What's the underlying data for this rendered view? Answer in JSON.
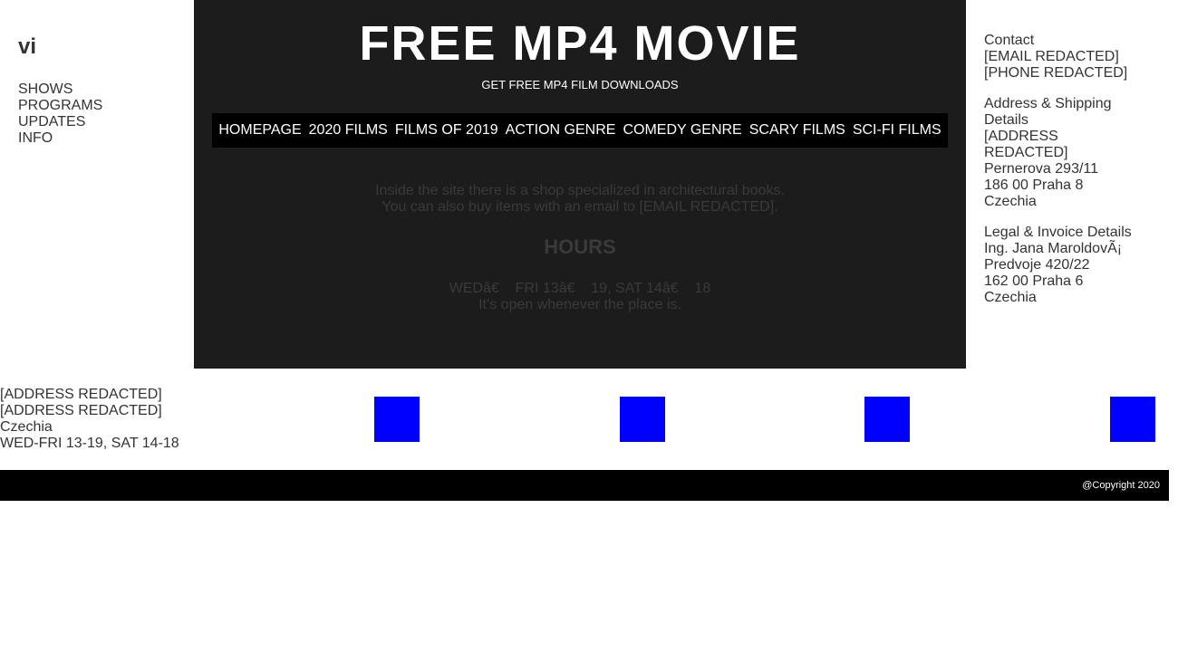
{
  "left_sidebar": {
    "abbr": "vi",
    "nav": [
      "SHOWS",
      "PROGRAMS",
      "UPDATES",
      "INFO"
    ]
  },
  "header": {
    "title": "FREE MP4 MOVIE",
    "subtitle": "GET FREE MP4 FILM DOWNLOADS"
  },
  "top_nav": [
    "HOMEPAGE",
    "2020 FILMS",
    "FILMS OF 2019",
    "ACTION GENRE",
    "COMEDY GENRE",
    "SCARY FILMS",
    "SCI-FI FILMS"
  ],
  "main": {
    "shop_line_1": "Inside the site there is a shop specialized in architectural books.",
    "shop_line_2": "You can also buy items with an email to [EMAIL REDACTED].",
    "hours_heading": "HOURS",
    "hours_line": "WEDâ€    FRI 13â€    19, SAT 14â€    18",
    "open_line": "It’s open whenever the place is."
  },
  "right_sidebar": {
    "contact": [
      "Contact",
      "[EMAIL REDACTED]",
      "[PHONE REDACTED]"
    ],
    "address": [
      "Address & Shipping",
      "Details",
      "[ADDRESS",
      "REDACTED]",
      "Pernerova 293/11",
      "186 00 Praha 8",
      "Czechia"
    ],
    "legal": [
      "Legal & Invoice Details",
      "Ing. Jana MaroldovÃ¡",
      "Predvoje 420/22",
      "162 00 Praha 6",
      "Czechia"
    ]
  },
  "info_row": {
    "address": [
      "[ADDRESS REDACTED]",
      "[ADDRESS REDACTED]",
      "Czechia",
      "WED-FRI 13-19, SAT 14-18"
    ]
  },
  "colors": {
    "main_bg": "#1c1c1c",
    "nav_bg": "#000000",
    "social_square": "#0000ff",
    "footer_bg": "#000000"
  },
  "footer": {
    "copyright": "@Copyright 2020"
  }
}
